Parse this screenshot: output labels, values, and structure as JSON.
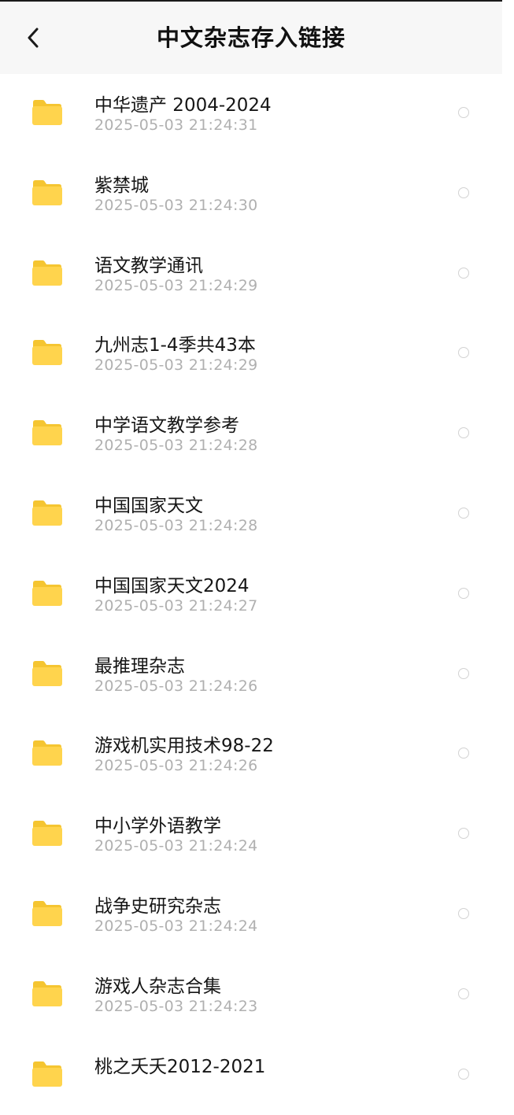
{
  "header": {
    "title": "中文杂志存入链接",
    "back_icon": "chevron-left-icon"
  },
  "colors": {
    "folder": "#FFD44D",
    "folder_tab": "#F5C531",
    "header_bg": "#F7F7F7",
    "timestamp": "#B0B0B0"
  },
  "items": [
    {
      "name": "中华遗产 2004-2024",
      "time": "2025-05-03  21:24:31"
    },
    {
      "name": "紫禁城",
      "time": "2025-05-03  21:24:30"
    },
    {
      "name": "语文教学通讯",
      "time": "2025-05-03  21:24:29"
    },
    {
      "name": "九州志1-4季共43本",
      "time": "2025-05-03  21:24:29"
    },
    {
      "name": "中学语文教学参考",
      "time": "2025-05-03  21:24:28"
    },
    {
      "name": "中国国家天文",
      "time": "2025-05-03  21:24:28"
    },
    {
      "name": "中国国家天文2024",
      "time": "2025-05-03  21:24:27"
    },
    {
      "name": "最推理杂志",
      "time": "2025-05-03  21:24:26"
    },
    {
      "name": "游戏机实用技术98-22",
      "time": "2025-05-03  21:24:26"
    },
    {
      "name": "中小学外语教学",
      "time": "2025-05-03  21:24:24"
    },
    {
      "name": "战争史研究杂志",
      "time": "2025-05-03  21:24:24"
    },
    {
      "name": "游戏人杂志合集",
      "time": "2025-05-03  21:24:23"
    },
    {
      "name": "桃之夭夭2012-2021",
      "time": ""
    }
  ]
}
